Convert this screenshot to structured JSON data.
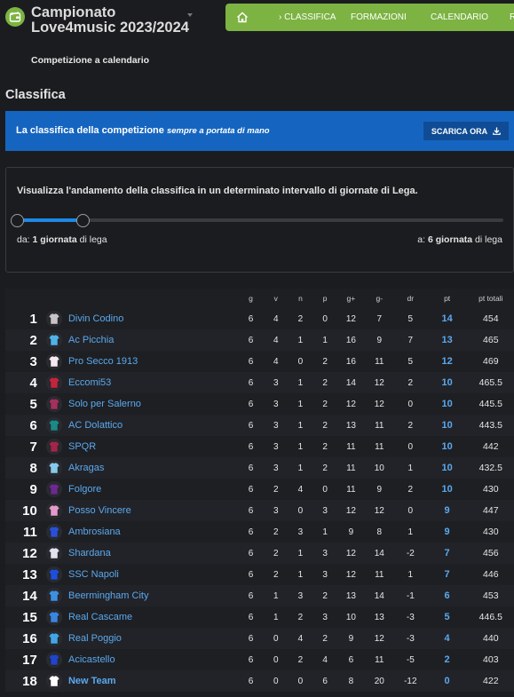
{
  "header": {
    "title": "Campionato Love4music 2023/2024",
    "subtitle": "Competizione a calendario",
    "logo_icon": "wallet-icon",
    "accent": "#7cb342"
  },
  "nav": {
    "home_icon": "home-icon",
    "items": [
      "› CLASSIFICA",
      "FORMAZIONI",
      "CALENDARIO",
      "R"
    ]
  },
  "section_title": "Classifica",
  "banner": {
    "text_bold": "La classifica della competizione",
    "text_italic": "sempre a portata di mano",
    "button": "SCARICA ORA",
    "button_icon": "download-icon",
    "color": "#1565c0"
  },
  "range": {
    "description": "Visualizza l'andamento della classifica in un determinato intervallo di giornate di Lega.",
    "from_prefix": "da:",
    "from_value": "1 giornata",
    "from_suffix": "di lega",
    "to_prefix": "a:",
    "to_value": "6 giornata",
    "to_suffix": "di lega",
    "min_giornata": 1,
    "max_giornata": 38,
    "selected_from": 1,
    "selected_to": 6
  },
  "table": {
    "headers": [
      "g",
      "v",
      "n",
      "p",
      "g+",
      "g-",
      "dr",
      "pt",
      "pt totali"
    ],
    "rows": [
      {
        "pos": "1",
        "team": "Divin Codino",
        "jersey": "#c8c3c7",
        "g": "6",
        "v": "4",
        "n": "2",
        "p": "0",
        "gp": "12",
        "gm": "7",
        "dr": "5",
        "pt": "14",
        "tot": "454"
      },
      {
        "pos": "2",
        "team": "Ac Picchia",
        "jersey": "#4fb3e8",
        "g": "6",
        "v": "4",
        "n": "1",
        "p": "1",
        "gp": "16",
        "gm": "9",
        "dr": "7",
        "pt": "13",
        "tot": "465"
      },
      {
        "pos": "3",
        "team": "Pro Secco 1913",
        "jersey": "#f3e9ee",
        "g": "6",
        "v": "4",
        "n": "0",
        "p": "2",
        "gp": "16",
        "gm": "11",
        "dr": "5",
        "pt": "12",
        "tot": "469"
      },
      {
        "pos": "4",
        "team": "Eccomi53",
        "jersey": "#c0263f",
        "g": "6",
        "v": "3",
        "n": "1",
        "p": "2",
        "gp": "14",
        "gm": "12",
        "dr": "2",
        "pt": "10",
        "tot": "465.5"
      },
      {
        "pos": "5",
        "team": "Solo per Salerno",
        "jersey": "#a3305e",
        "g": "6",
        "v": "3",
        "n": "1",
        "p": "2",
        "gp": "12",
        "gm": "12",
        "dr": "0",
        "pt": "10",
        "tot": "445.5"
      },
      {
        "pos": "6",
        "team": "AC Dolattico",
        "jersey": "#1a8a88",
        "g": "6",
        "v": "3",
        "n": "1",
        "p": "2",
        "gp": "13",
        "gm": "11",
        "dr": "2",
        "pt": "10",
        "tot": "443.5"
      },
      {
        "pos": "7",
        "team": "SPQR",
        "jersey": "#a0264a",
        "g": "6",
        "v": "3",
        "n": "1",
        "p": "2",
        "gp": "11",
        "gm": "11",
        "dr": "0",
        "pt": "10",
        "tot": "442"
      },
      {
        "pos": "8",
        "team": "Akragas",
        "jersey": "#86c9ea",
        "g": "6",
        "v": "3",
        "n": "1",
        "p": "2",
        "gp": "11",
        "gm": "10",
        "dr": "1",
        "pt": "10",
        "tot": "432.5"
      },
      {
        "pos": "9",
        "team": "Folgore",
        "jersey": "#6b2a8e",
        "g": "6",
        "v": "2",
        "n": "4",
        "p": "0",
        "gp": "11",
        "gm": "9",
        "dr": "2",
        "pt": "10",
        "tot": "430"
      },
      {
        "pos": "10",
        "team": "Posso Vincere",
        "jersey": "#e39acb",
        "g": "6",
        "v": "3",
        "n": "0",
        "p": "3",
        "gp": "12",
        "gm": "12",
        "dr": "0",
        "pt": "9",
        "tot": "447"
      },
      {
        "pos": "11",
        "team": "Ambrosiana",
        "jersey": "#2a4fd6",
        "g": "6",
        "v": "2",
        "n": "3",
        "p": "1",
        "gp": "9",
        "gm": "8",
        "dr": "1",
        "pt": "9",
        "tot": "430"
      },
      {
        "pos": "12",
        "team": "Shardana",
        "jersey": "#e0e2ee",
        "g": "6",
        "v": "2",
        "n": "1",
        "p": "3",
        "gp": "12",
        "gm": "14",
        "dr": "-2",
        "pt": "7",
        "tot": "456"
      },
      {
        "pos": "13",
        "team": "SSC Napoli",
        "jersey": "#1f4fd8",
        "g": "6",
        "v": "2",
        "n": "1",
        "p": "3",
        "gp": "12",
        "gm": "11",
        "dr": "1",
        "pt": "7",
        "tot": "446"
      },
      {
        "pos": "14",
        "team": "Beermingham City",
        "jersey": "#3f8fe0",
        "g": "6",
        "v": "1",
        "n": "3",
        "p": "2",
        "gp": "13",
        "gm": "14",
        "dr": "-1",
        "pt": "6",
        "tot": "453"
      },
      {
        "pos": "15",
        "team": "Real Cascame",
        "jersey": "#3a86de",
        "g": "6",
        "v": "1",
        "n": "2",
        "p": "3",
        "gp": "10",
        "gm": "13",
        "dr": "-3",
        "pt": "5",
        "tot": "446.5"
      },
      {
        "pos": "16",
        "team": "Real Poggio",
        "jersey": "#41a6e8",
        "g": "6",
        "v": "0",
        "n": "4",
        "p": "2",
        "gp": "9",
        "gm": "12",
        "dr": "-3",
        "pt": "4",
        "tot": "440"
      },
      {
        "pos": "17",
        "team": "Acicastello",
        "jersey": "#2244c9",
        "g": "6",
        "v": "0",
        "n": "2",
        "p": "4",
        "gp": "6",
        "gm": "11",
        "dr": "-5",
        "pt": "2",
        "tot": "403"
      },
      {
        "pos": "18",
        "team": "New Team",
        "jersey": "#ffffff",
        "g": "6",
        "v": "0",
        "n": "0",
        "p": "6",
        "gp": "8",
        "gm": "20",
        "dr": "-12",
        "pt": "0",
        "tot": "422",
        "bold": true
      }
    ]
  }
}
